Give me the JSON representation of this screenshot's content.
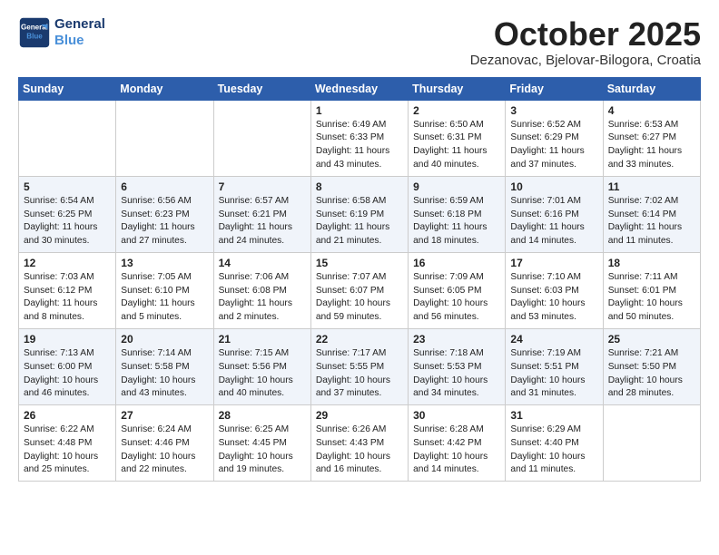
{
  "header": {
    "logo_line1": "General",
    "logo_line2": "Blue",
    "month": "October 2025",
    "location": "Dezanovac, Bjelovar-Bilogora, Croatia"
  },
  "days_of_week": [
    "Sunday",
    "Monday",
    "Tuesday",
    "Wednesday",
    "Thursday",
    "Friday",
    "Saturday"
  ],
  "weeks": [
    [
      {
        "day": "",
        "content": ""
      },
      {
        "day": "",
        "content": ""
      },
      {
        "day": "",
        "content": ""
      },
      {
        "day": "1",
        "content": "Sunrise: 6:49 AM\nSunset: 6:33 PM\nDaylight: 11 hours\nand 43 minutes."
      },
      {
        "day": "2",
        "content": "Sunrise: 6:50 AM\nSunset: 6:31 PM\nDaylight: 11 hours\nand 40 minutes."
      },
      {
        "day": "3",
        "content": "Sunrise: 6:52 AM\nSunset: 6:29 PM\nDaylight: 11 hours\nand 37 minutes."
      },
      {
        "day": "4",
        "content": "Sunrise: 6:53 AM\nSunset: 6:27 PM\nDaylight: 11 hours\nand 33 minutes."
      }
    ],
    [
      {
        "day": "5",
        "content": "Sunrise: 6:54 AM\nSunset: 6:25 PM\nDaylight: 11 hours\nand 30 minutes."
      },
      {
        "day": "6",
        "content": "Sunrise: 6:56 AM\nSunset: 6:23 PM\nDaylight: 11 hours\nand 27 minutes."
      },
      {
        "day": "7",
        "content": "Sunrise: 6:57 AM\nSunset: 6:21 PM\nDaylight: 11 hours\nand 24 minutes."
      },
      {
        "day": "8",
        "content": "Sunrise: 6:58 AM\nSunset: 6:19 PM\nDaylight: 11 hours\nand 21 minutes."
      },
      {
        "day": "9",
        "content": "Sunrise: 6:59 AM\nSunset: 6:18 PM\nDaylight: 11 hours\nand 18 minutes."
      },
      {
        "day": "10",
        "content": "Sunrise: 7:01 AM\nSunset: 6:16 PM\nDaylight: 11 hours\nand 14 minutes."
      },
      {
        "day": "11",
        "content": "Sunrise: 7:02 AM\nSunset: 6:14 PM\nDaylight: 11 hours\nand 11 minutes."
      }
    ],
    [
      {
        "day": "12",
        "content": "Sunrise: 7:03 AM\nSunset: 6:12 PM\nDaylight: 11 hours\nand 8 minutes."
      },
      {
        "day": "13",
        "content": "Sunrise: 7:05 AM\nSunset: 6:10 PM\nDaylight: 11 hours\nand 5 minutes."
      },
      {
        "day": "14",
        "content": "Sunrise: 7:06 AM\nSunset: 6:08 PM\nDaylight: 11 hours\nand 2 minutes."
      },
      {
        "day": "15",
        "content": "Sunrise: 7:07 AM\nSunset: 6:07 PM\nDaylight: 10 hours\nand 59 minutes."
      },
      {
        "day": "16",
        "content": "Sunrise: 7:09 AM\nSunset: 6:05 PM\nDaylight: 10 hours\nand 56 minutes."
      },
      {
        "day": "17",
        "content": "Sunrise: 7:10 AM\nSunset: 6:03 PM\nDaylight: 10 hours\nand 53 minutes."
      },
      {
        "day": "18",
        "content": "Sunrise: 7:11 AM\nSunset: 6:01 PM\nDaylight: 10 hours\nand 50 minutes."
      }
    ],
    [
      {
        "day": "19",
        "content": "Sunrise: 7:13 AM\nSunset: 6:00 PM\nDaylight: 10 hours\nand 46 minutes."
      },
      {
        "day": "20",
        "content": "Sunrise: 7:14 AM\nSunset: 5:58 PM\nDaylight: 10 hours\nand 43 minutes."
      },
      {
        "day": "21",
        "content": "Sunrise: 7:15 AM\nSunset: 5:56 PM\nDaylight: 10 hours\nand 40 minutes."
      },
      {
        "day": "22",
        "content": "Sunrise: 7:17 AM\nSunset: 5:55 PM\nDaylight: 10 hours\nand 37 minutes."
      },
      {
        "day": "23",
        "content": "Sunrise: 7:18 AM\nSunset: 5:53 PM\nDaylight: 10 hours\nand 34 minutes."
      },
      {
        "day": "24",
        "content": "Sunrise: 7:19 AM\nSunset: 5:51 PM\nDaylight: 10 hours\nand 31 minutes."
      },
      {
        "day": "25",
        "content": "Sunrise: 7:21 AM\nSunset: 5:50 PM\nDaylight: 10 hours\nand 28 minutes."
      }
    ],
    [
      {
        "day": "26",
        "content": "Sunrise: 6:22 AM\nSunset: 4:48 PM\nDaylight: 10 hours\nand 25 minutes."
      },
      {
        "day": "27",
        "content": "Sunrise: 6:24 AM\nSunset: 4:46 PM\nDaylight: 10 hours\nand 22 minutes."
      },
      {
        "day": "28",
        "content": "Sunrise: 6:25 AM\nSunset: 4:45 PM\nDaylight: 10 hours\nand 19 minutes."
      },
      {
        "day": "29",
        "content": "Sunrise: 6:26 AM\nSunset: 4:43 PM\nDaylight: 10 hours\nand 16 minutes."
      },
      {
        "day": "30",
        "content": "Sunrise: 6:28 AM\nSunset: 4:42 PM\nDaylight: 10 hours\nand 14 minutes."
      },
      {
        "day": "31",
        "content": "Sunrise: 6:29 AM\nSunset: 4:40 PM\nDaylight: 10 hours\nand 11 minutes."
      },
      {
        "day": "",
        "content": ""
      }
    ]
  ]
}
